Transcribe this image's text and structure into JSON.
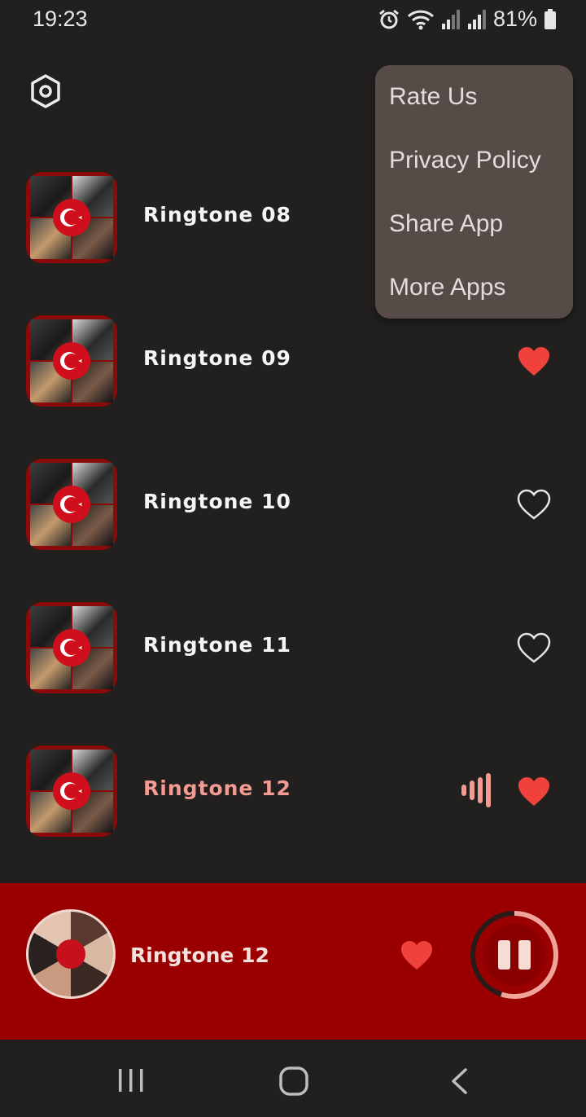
{
  "status_bar": {
    "time": "19:23",
    "battery": "81%"
  },
  "menu": {
    "items": [
      "Rate Us",
      "Privacy Policy",
      "Share App",
      "More Apps"
    ]
  },
  "ringtones": [
    {
      "title": "Ringtone 08",
      "favorite": false,
      "playing": false
    },
    {
      "title": "Ringtone 09",
      "favorite": true,
      "playing": false
    },
    {
      "title": "Ringtone 10",
      "favorite": false,
      "playing": false
    },
    {
      "title": "Ringtone 11",
      "favorite": false,
      "playing": false
    },
    {
      "title": "Ringtone 12",
      "favorite": true,
      "playing": true
    }
  ],
  "now_playing": {
    "title": "Ringtone 12",
    "favorite": true,
    "progress": 0.55
  },
  "colors": {
    "background": "#221f1f",
    "accent": "#9a0000",
    "heart": "#f0423c",
    "active_text": "#f39a92",
    "menu_bg": "#574b48"
  },
  "icons": {
    "settings": "hexagon-gear-icon",
    "favorite": "heart-icon",
    "playing": "equalizer-bars-icon",
    "pause": "pause-icon",
    "nav_recents": "recents-icon",
    "nav_home": "home-icon",
    "nav_back": "back-icon"
  }
}
